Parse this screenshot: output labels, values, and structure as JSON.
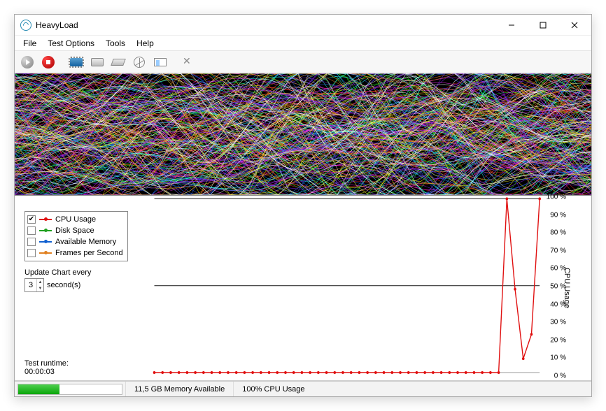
{
  "window": {
    "title": "HeavyLoad"
  },
  "menubar": {
    "items": [
      "File",
      "Test Options",
      "Tools",
      "Help"
    ]
  },
  "toolbar": {
    "buttons": [
      {
        "name": "play-button",
        "icon": "play"
      },
      {
        "name": "stop-button",
        "icon": "stop"
      },
      {
        "sep": true
      },
      {
        "name": "cpu-button",
        "icon": "chip"
      },
      {
        "name": "disk-button",
        "icon": "disk"
      },
      {
        "name": "memory-button",
        "icon": "mem"
      },
      {
        "name": "fps-button",
        "icon": "fan"
      },
      {
        "name": "panel-button",
        "icon": "panel"
      },
      {
        "sep": true
      },
      {
        "name": "settings-button",
        "icon": "wrench"
      }
    ]
  },
  "legend": {
    "items": [
      {
        "label": "CPU Usage",
        "color": "#e01010",
        "checked": true
      },
      {
        "label": "Disk Space",
        "color": "#20a020",
        "checked": false
      },
      {
        "label": "Available Memory",
        "color": "#1060d0",
        "checked": false
      },
      {
        "label": "Frames per Second",
        "color": "#e08020",
        "checked": false
      }
    ]
  },
  "chart_controls": {
    "update_label": "Update Chart every",
    "update_value": "3",
    "update_unit": "second(s)",
    "runtime_label": "Test runtime:",
    "runtime_value": "00:00:03"
  },
  "chart_data": {
    "type": "line",
    "series_name": "CPU Usage",
    "axis_label": "CPU Usage",
    "ylim": [
      0,
      100
    ],
    "y_ticks": [
      "100 %",
      "90 %",
      "80 %",
      "70 %",
      "60 %",
      "50 %",
      "40 %",
      "30 %",
      "20 %",
      "10 %",
      "0 %"
    ],
    "values": [
      0,
      0,
      0,
      0,
      0,
      0,
      0,
      0,
      0,
      0,
      0,
      0,
      0,
      0,
      0,
      0,
      0,
      0,
      0,
      0,
      0,
      0,
      0,
      0,
      0,
      0,
      0,
      0,
      0,
      0,
      0,
      0,
      0,
      0,
      0,
      0,
      0,
      0,
      0,
      0,
      0,
      0,
      0,
      100,
      48,
      8,
      22,
      100
    ],
    "gridlines_at": [
      50,
      100
    ]
  },
  "statusbar": {
    "memory_available": "11,5 GB Memory Available",
    "cpu_usage": "100% CPU Usage",
    "progress_percent": 40
  },
  "colors": {
    "cpu_line": "#e01010",
    "grid": "#333"
  }
}
